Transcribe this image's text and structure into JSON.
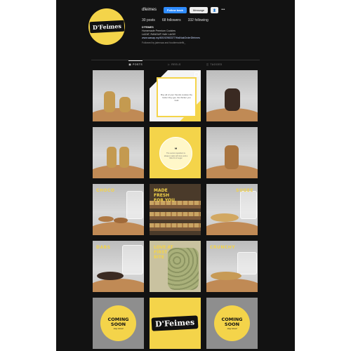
{
  "profile": {
    "username": "dfeimes",
    "logo_text": "D'Feimes",
    "follow_label": "Follow back",
    "message_label": "Message",
    "more_label": "•••",
    "stats": {
      "posts": "30 posts",
      "followers": "68 followers",
      "following": "332 following"
    },
    "bio": {
      "name": "D'FEIMES",
      "line1": "Homemade Premium Cookies",
      "line2": "LAZAT, RANGUP, NAK LAGI!!",
      "link": "www.wasap.my/60192983377/HaiNakOrderDfeimes",
      "followed_by": "Followed by jaiensaa and foodiemodelfk_"
    }
  },
  "tabs": [
    {
      "label": "POSTS",
      "active": true,
      "icon": "grid-icon"
    },
    {
      "label": "REELS",
      "active": false,
      "icon": "reels-icon"
    },
    {
      "label": "TAGGED",
      "active": false,
      "icon": "tag-icon"
    }
  ],
  "posts": {
    "quote1": "Buy all of your friends cookies the better they get, the thicker you hold",
    "quote2": "The secret ingredient is always made with love and a little bit of sugar",
    "choco": "CHOCO",
    "sugee": "SUGEE",
    "made_fresh": "MADE FRESH FOR YOU",
    "love_at_first_bite": "LOVE AT FIRST BITE",
    "dabs": "DABS",
    "crunchy": "CRUNCHY",
    "coming_soon": "COMING SOON",
    "stay_tuned": "stay tuned",
    "logo": "D'Feimes"
  },
  "colors": {
    "background": "#121212",
    "brand_yellow": "#f4d44a",
    "follow_blue": "#2f8cff"
  }
}
